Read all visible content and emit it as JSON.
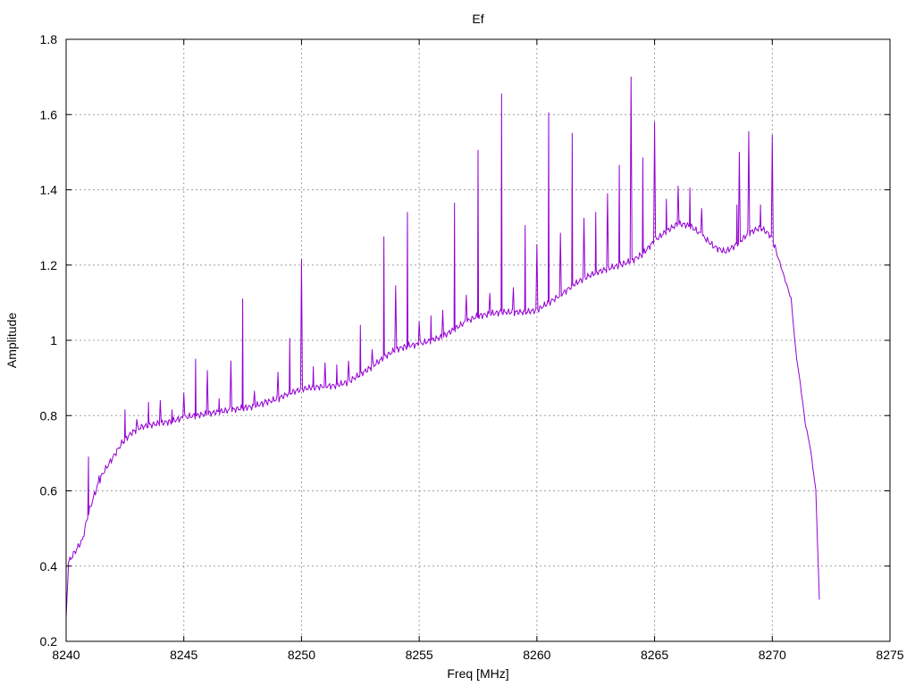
{
  "chart_data": {
    "type": "line",
    "title": "Ef",
    "xlabel": "Freq [MHz]",
    "ylabel": "Amplitude",
    "xlim": [
      8240,
      8275
    ],
    "ylim": [
      0.2,
      1.8
    ],
    "xticks": [
      "8240",
      "8245",
      "8250",
      "8255",
      "8260",
      "8265",
      "8270",
      "8275"
    ],
    "yticks": [
      "0.2",
      "0.4",
      "0.6",
      "0.8",
      "1",
      "1.2",
      "1.4",
      "1.6",
      "1.8"
    ],
    "grid": true,
    "legend": "none",
    "series": [
      {
        "color": "#9400d3",
        "baseline": [
          [
            8240.0,
            0.26
          ],
          [
            8240.1,
            0.41
          ],
          [
            8240.3,
            0.43
          ],
          [
            8240.5,
            0.45
          ],
          [
            8240.7,
            0.47
          ],
          [
            8240.9,
            0.53
          ],
          [
            8241.2,
            0.59
          ],
          [
            8241.5,
            0.64
          ],
          [
            8241.8,
            0.67
          ],
          [
            8242.1,
            0.7
          ],
          [
            8242.4,
            0.73
          ],
          [
            8242.8,
            0.755
          ],
          [
            8243.2,
            0.77
          ],
          [
            8243.6,
            0.775
          ],
          [
            8244.0,
            0.78
          ],
          [
            8244.5,
            0.785
          ],
          [
            8245.0,
            0.795
          ],
          [
            8245.5,
            0.8
          ],
          [
            8246.0,
            0.805
          ],
          [
            8246.5,
            0.81
          ],
          [
            8247.0,
            0.815
          ],
          [
            8247.5,
            0.82
          ],
          [
            8248.0,
            0.825
          ],
          [
            8248.5,
            0.835
          ],
          [
            8249.0,
            0.845
          ],
          [
            8249.5,
            0.86
          ],
          [
            8250.0,
            0.87
          ],
          [
            8250.5,
            0.875
          ],
          [
            8251.0,
            0.878
          ],
          [
            8251.5,
            0.88
          ],
          [
            8252.0,
            0.89
          ],
          [
            8252.5,
            0.91
          ],
          [
            8253.0,
            0.93
          ],
          [
            8253.5,
            0.955
          ],
          [
            8254.0,
            0.975
          ],
          [
            8254.5,
            0.985
          ],
          [
            8255.0,
            0.99
          ],
          [
            8255.5,
            1.0
          ],
          [
            8256.0,
            1.01
          ],
          [
            8256.5,
            1.03
          ],
          [
            8257.0,
            1.05
          ],
          [
            8257.5,
            1.065
          ],
          [
            8258.0,
            1.07
          ],
          [
            8258.5,
            1.075
          ],
          [
            8259.0,
            1.075
          ],
          [
            8259.5,
            1.075
          ],
          [
            8260.0,
            1.08
          ],
          [
            8260.5,
            1.1
          ],
          [
            8261.0,
            1.12
          ],
          [
            8261.5,
            1.145
          ],
          [
            8262.0,
            1.165
          ],
          [
            8262.5,
            1.18
          ],
          [
            8263.0,
            1.19
          ],
          [
            8263.5,
            1.2
          ],
          [
            8264.0,
            1.21
          ],
          [
            8264.5,
            1.23
          ],
          [
            8265.0,
            1.265
          ],
          [
            8265.5,
            1.29
          ],
          [
            8266.0,
            1.31
          ],
          [
            8266.5,
            1.305
          ],
          [
            8267.0,
            1.28
          ],
          [
            8267.5,
            1.25
          ],
          [
            8268.0,
            1.235
          ],
          [
            8268.5,
            1.255
          ],
          [
            8269.0,
            1.285
          ],
          [
            8269.5,
            1.3
          ],
          [
            8269.9,
            1.28
          ],
          [
            8270.1,
            1.25
          ],
          [
            8270.4,
            1.19
          ],
          [
            8270.6,
            1.15
          ],
          [
            8270.8,
            1.11
          ],
          [
            8271.0,
            0.97
          ],
          [
            8271.2,
            0.88
          ],
          [
            8271.4,
            0.78
          ],
          [
            8271.6,
            0.72
          ],
          [
            8271.75,
            0.65
          ],
          [
            8271.85,
            0.6
          ],
          [
            8272.0,
            0.31
          ]
        ],
        "spikes": [
          [
            8240.95,
            0.69
          ],
          [
            8241.4,
            0.64
          ],
          [
            8242.5,
            0.815
          ],
          [
            8243.0,
            0.79
          ],
          [
            8243.5,
            0.835
          ],
          [
            8244.0,
            0.84
          ],
          [
            8244.5,
            0.815
          ],
          [
            8245.0,
            0.86
          ],
          [
            8245.5,
            0.95
          ],
          [
            8246.0,
            0.92
          ],
          [
            8246.5,
            0.845
          ],
          [
            8247.0,
            0.945
          ],
          [
            8247.5,
            1.11
          ],
          [
            8248.0,
            0.865
          ],
          [
            8248.5,
            0.84
          ],
          [
            8249.0,
            0.915
          ],
          [
            8249.5,
            1.005
          ],
          [
            8250.0,
            1.215
          ],
          [
            8250.5,
            0.93
          ],
          [
            8251.0,
            0.94
          ],
          [
            8251.5,
            0.935
          ],
          [
            8252.0,
            0.945
          ],
          [
            8252.5,
            1.04
          ],
          [
            8253.0,
            0.975
          ],
          [
            8253.5,
            1.275
          ],
          [
            8254.0,
            1.145
          ],
          [
            8254.5,
            1.34
          ],
          [
            8255.0,
            1.05
          ],
          [
            8255.5,
            1.065
          ],
          [
            8256.0,
            1.08
          ],
          [
            8256.5,
            1.365
          ],
          [
            8257.0,
            1.12
          ],
          [
            8257.5,
            1.505
          ],
          [
            8258.0,
            1.125
          ],
          [
            8258.5,
            1.655
          ],
          [
            8259.0,
            1.14
          ],
          [
            8259.5,
            1.305
          ],
          [
            8260.0,
            1.255
          ],
          [
            8260.5,
            1.605
          ],
          [
            8261.0,
            1.285
          ],
          [
            8261.5,
            1.55
          ],
          [
            8262.0,
            1.325
          ],
          [
            8262.5,
            1.34
          ],
          [
            8263.0,
            1.39
          ],
          [
            8263.5,
            1.465
          ],
          [
            8264.0,
            1.7
          ],
          [
            8264.5,
            1.485
          ],
          [
            8265.0,
            1.58
          ],
          [
            8265.5,
            1.375
          ],
          [
            8266.0,
            1.41
          ],
          [
            8266.5,
            1.405
          ],
          [
            8267.0,
            1.35
          ],
          [
            8268.5,
            1.36
          ],
          [
            8268.6,
            1.5
          ],
          [
            8269.0,
            1.555
          ],
          [
            8269.5,
            1.36
          ],
          [
            8270.0,
            1.545
          ]
        ]
      }
    ]
  }
}
